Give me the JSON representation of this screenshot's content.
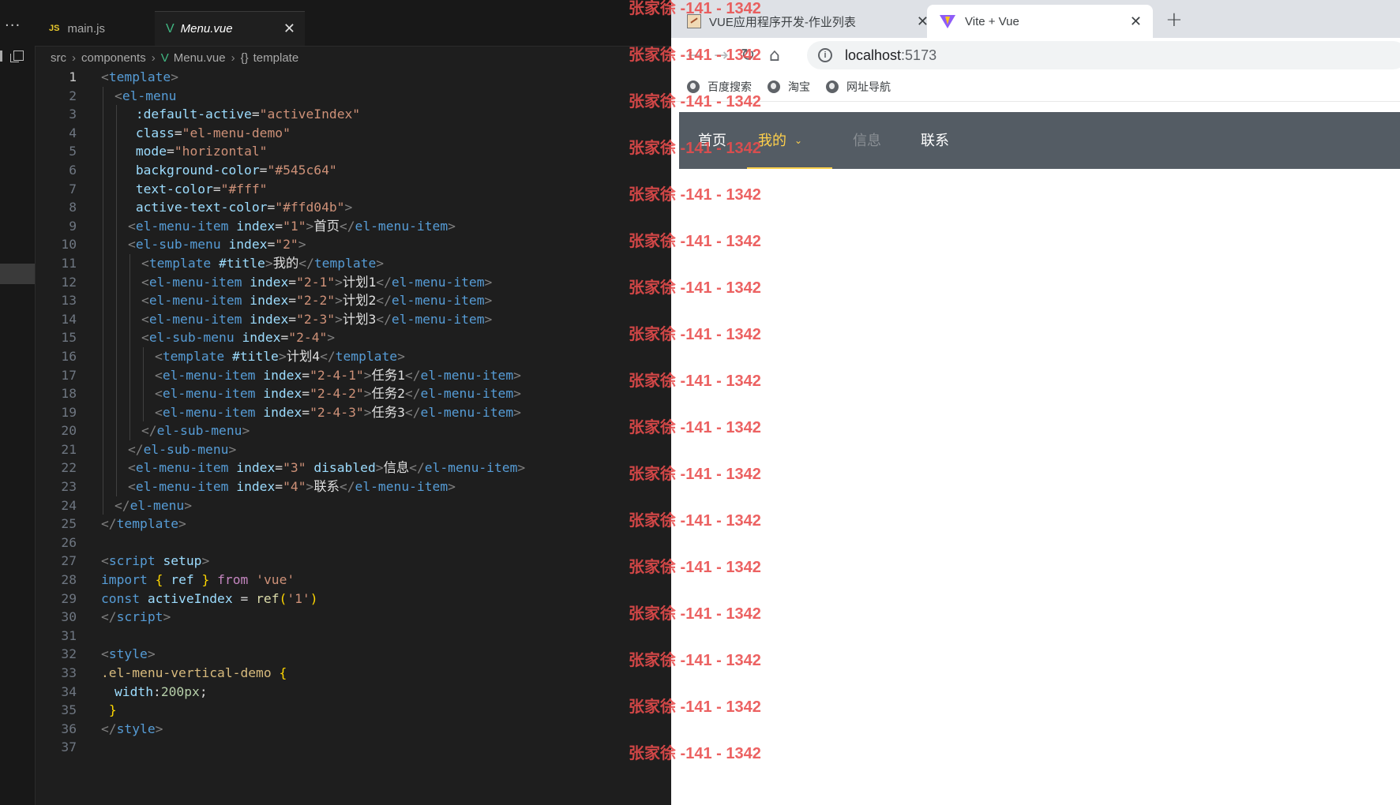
{
  "editor": {
    "tabs": [
      {
        "label": "main.js",
        "icon": "JS"
      },
      {
        "label": "Menu.vue",
        "icon": "V",
        "close": "✕"
      }
    ],
    "breadcrumb": {
      "parts": [
        "src",
        "components",
        "Menu.vue",
        "template"
      ],
      "brace": "{}"
    },
    "current_line": 1,
    "lines": [
      {
        "n": "1"
      },
      {
        "n": "2"
      },
      {
        "n": "3"
      },
      {
        "n": "4"
      },
      {
        "n": "5"
      },
      {
        "n": "6"
      },
      {
        "n": "7"
      },
      {
        "n": "8"
      },
      {
        "n": "9"
      },
      {
        "n": "10"
      },
      {
        "n": "11"
      },
      {
        "n": "12"
      },
      {
        "n": "13"
      },
      {
        "n": "14"
      },
      {
        "n": "15"
      },
      {
        "n": "16"
      },
      {
        "n": "17"
      },
      {
        "n": "18"
      },
      {
        "n": "19"
      },
      {
        "n": "20"
      },
      {
        "n": "21"
      },
      {
        "n": "22"
      },
      {
        "n": "23"
      },
      {
        "n": "24"
      },
      {
        "n": "25"
      },
      {
        "n": "26"
      },
      {
        "n": "27"
      },
      {
        "n": "28"
      },
      {
        "n": "29"
      },
      {
        "n": "30"
      },
      {
        "n": "31"
      },
      {
        "n": "32"
      },
      {
        "n": "33"
      },
      {
        "n": "34"
      },
      {
        "n": "35"
      },
      {
        "n": "36"
      },
      {
        "n": "37"
      }
    ],
    "code": {
      "l1": {
        "open": "<",
        "name": "template",
        "close": ">"
      },
      "l2": {
        "open": "<",
        "name": "el-menu"
      },
      "l3": {
        "attr": ":default-active",
        "eq": "=",
        "val": "\"activeIndex\""
      },
      "l4": {
        "attr": "class",
        "eq": "=",
        "val": "\"el-menu-demo\""
      },
      "l5": {
        "attr": "mode",
        "eq": "=",
        "val": "\"horizontal\""
      },
      "l6": {
        "attr": "background-color",
        "eq": "=",
        "val": "\"#545c64\""
      },
      "l7": {
        "attr": "text-color",
        "eq": "=",
        "val": "\"#fff\""
      },
      "l8": {
        "attr": "active-text-color",
        "eq": "=",
        "val": "\"#ffd04b\"",
        "close": ">"
      },
      "l9": {
        "open": "<",
        "name": "el-menu-item",
        "attr": "index",
        "eq": "=",
        "val": "\"1\"",
        "close": ">",
        "text": "首页",
        "endopen": "</",
        "endname": "el-menu-item",
        "endclose": ">"
      },
      "l10": {
        "open": "<",
        "name": "el-sub-menu",
        "attr": "index",
        "eq": "=",
        "val": "\"2\"",
        "close": ">"
      },
      "l11": {
        "open": "<",
        "name": "template",
        "attr": "#title",
        "close": ">",
        "text": "我的",
        "endopen": "</",
        "endname": "template",
        "endclose": ">"
      },
      "l12": {
        "open": "<",
        "name": "el-menu-item",
        "attr": "index",
        "eq": "=",
        "val": "\"2-1\"",
        "close": ">",
        "text": "计划1",
        "endopen": "</",
        "endname": "el-menu-item",
        "endclose": ">"
      },
      "l13": {
        "open": "<",
        "name": "el-menu-item",
        "attr": "index",
        "eq": "=",
        "val": "\"2-2\"",
        "close": ">",
        "text": "计划2",
        "endopen": "</",
        "endname": "el-menu-item",
        "endclose": ">"
      },
      "l14": {
        "open": "<",
        "name": "el-menu-item",
        "attr": "index",
        "eq": "=",
        "val": "\"2-3\"",
        "close": ">",
        "text": "计划3",
        "endopen": "</",
        "endname": "el-menu-item",
        "endclose": ">"
      },
      "l15": {
        "open": "<",
        "name": "el-sub-menu",
        "attr": "index",
        "eq": "=",
        "val": "\"2-4\"",
        "close": ">"
      },
      "l16": {
        "open": "<",
        "name": "template",
        "attr": "#title",
        "close": ">",
        "text": "计划4",
        "endopen": "</",
        "endname": "template",
        "endclose": ">"
      },
      "l17": {
        "open": "<",
        "name": "el-menu-item",
        "attr": "index",
        "eq": "=",
        "val": "\"2-4-1\"",
        "close": ">",
        "text": "任务1",
        "endopen": "</",
        "endname": "el-menu-item",
        "endclose": ">"
      },
      "l18": {
        "open": "<",
        "name": "el-menu-item",
        "attr": "index",
        "eq": "=",
        "val": "\"2-4-2\"",
        "close": ">",
        "text": "任务2",
        "endopen": "</",
        "endname": "el-menu-item",
        "endclose": ">"
      },
      "l19": {
        "open": "<",
        "name": "el-menu-item",
        "attr": "index",
        "eq": "=",
        "val": "\"2-4-3\"",
        "close": ">",
        "text": "任务3",
        "endopen": "</",
        "endname": "el-menu-item",
        "endclose": ">"
      },
      "l20": {
        "endopen": "</",
        "endname": "el-sub-menu",
        "endclose": ">"
      },
      "l21": {
        "endopen": "</",
        "endname": "el-sub-menu",
        "endclose": ">"
      },
      "l22": {
        "open": "<",
        "name": "el-menu-item",
        "attr": "index",
        "eq": "=",
        "val": "\"3\"",
        "attr2": "disabled",
        "close": ">",
        "text": "信息",
        "endopen": "</",
        "endname": "el-menu-item",
        "endclose": ">"
      },
      "l23": {
        "open": "<",
        "name": "el-menu-item",
        "attr": "index",
        "eq": "=",
        "val": "\"4\"",
        "close": ">",
        "text": "联系",
        "endopen": "</",
        "endname": "el-menu-item",
        "endclose": ">"
      },
      "l24": {
        "endopen": "</",
        "endname": "el-menu",
        "endclose": ">"
      },
      "l25": {
        "endopen": "</",
        "endname": "template",
        "endclose": ">"
      },
      "l27": {
        "open": "<",
        "name": "script",
        "attr": "setup",
        "close": ">"
      },
      "l28": {
        "kw": "import",
        "lb": "{",
        "id": "ref",
        "rb": "}",
        "kw2": "from",
        "str": "'vue'"
      },
      "l29": {
        "kw": "const",
        "id": "activeIndex",
        "op": "=",
        "fn": "ref",
        "lp": "(",
        "str": "'1'",
        "rp": ")"
      },
      "l30": {
        "endopen": "</",
        "endname": "script",
        "endclose": ">"
      },
      "l32": {
        "open": "<",
        "name": "style",
        "close": ">"
      },
      "l33": {
        "selector": ".el-menu-vertical-demo",
        "lb": "{"
      },
      "l34": {
        "prop": "width",
        "colon": ":",
        "num": "200px",
        "semi": ";"
      },
      "l35": {
        "rb": "}"
      },
      "l36": {
        "endopen": "</",
        "endname": "style",
        "endclose": ">"
      }
    }
  },
  "browser": {
    "tabs": [
      {
        "label": "VUE应用程序开发-作业列表",
        "close": "✕"
      },
      {
        "label": "Vite + Vue",
        "close": "✕"
      }
    ],
    "new_tab": "+",
    "nav": {
      "back": "←",
      "forward": "→",
      "reload": "↻",
      "home": "⌂"
    },
    "url": {
      "host": "localhost",
      "port": ":5173",
      "info_icon": "i"
    },
    "bookmarks": [
      "百度搜索",
      "淘宝",
      "网址导航"
    ],
    "menu": {
      "background": "#545c64",
      "text_color": "#fff",
      "active_text_color": "#ffd04b",
      "items": [
        {
          "label": "首页"
        },
        {
          "label": "我的",
          "active": true,
          "arrow": "⌄"
        },
        {
          "label": "信息",
          "disabled": true
        },
        {
          "label": "联系"
        }
      ]
    }
  },
  "watermark": {
    "text": "张家徐 -141 - 1342",
    "count": 17
  }
}
